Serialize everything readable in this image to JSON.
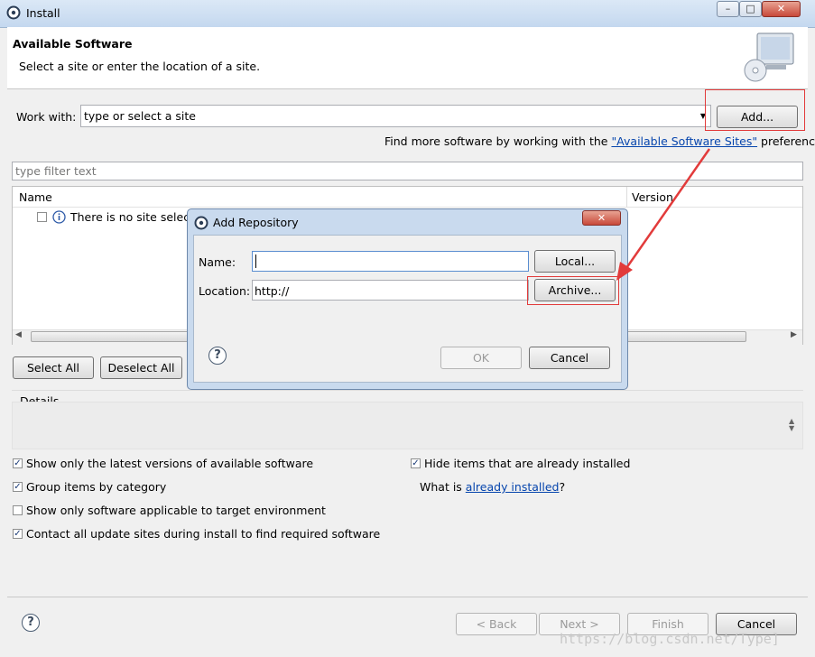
{
  "window": {
    "title": "Install",
    "controls": {
      "minimize": "–",
      "maximize": "□",
      "close": "✕"
    }
  },
  "header": {
    "title": "Available Software",
    "subtitle": "Select a site or enter the location of a site."
  },
  "work_with": {
    "label": "Work with:",
    "value": "type or select a site",
    "add_button": "Add..."
  },
  "find_more": {
    "prefix": "Find more software by working with the ",
    "link": "\"Available Software Sites\"",
    "suffix": " preferences."
  },
  "filter": {
    "placeholder": "type filter text"
  },
  "table": {
    "columns": [
      "Name",
      "Version"
    ],
    "rows": [
      {
        "text": "There is no site selected.",
        "checked": false
      }
    ]
  },
  "selection_buttons": {
    "select_all": "Select All",
    "deselect_all": "Deselect All"
  },
  "details": {
    "label": "Details"
  },
  "options": {
    "latest_versions": {
      "label": "Show only the latest versions of available software",
      "checked": true
    },
    "group_by_category": {
      "label": "Group items by category",
      "checked": true
    },
    "target_env": {
      "label": "Show only software applicable to target environment",
      "checked": false
    },
    "contact_sites": {
      "label": "Contact all update sites during install to find required software",
      "checked": true
    },
    "hide_installed": {
      "label": "Hide items that are already installed",
      "checked": true
    },
    "what_is_prefix": "What is ",
    "what_is_link": "already installed",
    "what_is_suffix": "?"
  },
  "footer": {
    "back": "< Back",
    "next": "Next >",
    "finish": "Finish",
    "cancel": "Cancel",
    "help": "?"
  },
  "dialog": {
    "title": "Add Repository",
    "name_label": "Name:",
    "name_value": "",
    "location_label": "Location:",
    "location_value": "http://",
    "local_button": "Local...",
    "archive_button": "Archive...",
    "ok_button": "OK",
    "cancel_button": "Cancel",
    "help": "?",
    "close": "✕"
  },
  "watermark": "https://blog.csdn.net/Type]",
  "colors": {
    "annotation_red": "#e23b3b",
    "link_blue": "#0645ad"
  }
}
